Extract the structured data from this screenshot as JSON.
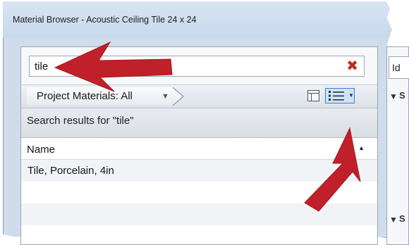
{
  "window": {
    "title": "Material Browser - Acoustic Ceiling Tile 24 x 24"
  },
  "search": {
    "value": "tile",
    "placeholder": "",
    "clear_icon": "close-x-icon",
    "clear_color": "#c62828"
  },
  "toolbar": {
    "filter_label": "Project Materials: All",
    "filter_icon": "dropdown-arrow-icon",
    "panel_icon": "panel-toggle-icon",
    "view_icon": "list-view-icon"
  },
  "results": {
    "header": "Search results for \"tile\""
  },
  "list": {
    "column_name": "Name",
    "sort_icon": "sort-ascending-icon",
    "rows": [
      "Tile, Porcelain, 4in"
    ]
  },
  "right_panel": {
    "tab_fragment": "Id",
    "section_fragment": "S"
  },
  "annotations": {
    "arrow_color": "#c0202a"
  }
}
